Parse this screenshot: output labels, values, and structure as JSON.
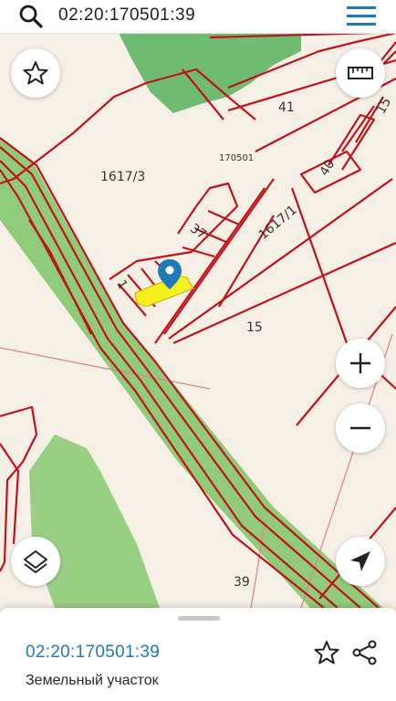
{
  "search": {
    "value": "02:20:170501:39"
  },
  "map": {
    "labels": {
      "p1617_3": "1617/3",
      "p41": "41",
      "p170501": "170501",
      "p40": "40",
      "p37": "37",
      "p1617_1": "1617/1",
      "p1": "1",
      "p15": "15",
      "p15b": "15",
      "p39": "39"
    },
    "colors": {
      "background": "#f6efe6",
      "forest": "#62b565",
      "road": "#8fcb78",
      "parcel_border": "#c1121b",
      "parcel_thin": "#d88a8a",
      "selected": "#f4f11e",
      "marker": "#1e7bb6"
    }
  },
  "buttons": {
    "favorite": "star-icon",
    "ruler": "ruler-icon",
    "zoom_in": "plus-icon",
    "zoom_out": "minus-icon",
    "layers": "layers-icon",
    "locate": "navigation-arrow-icon"
  },
  "sheet": {
    "code": "02:20:170501:39",
    "type": "Земельный участок"
  }
}
